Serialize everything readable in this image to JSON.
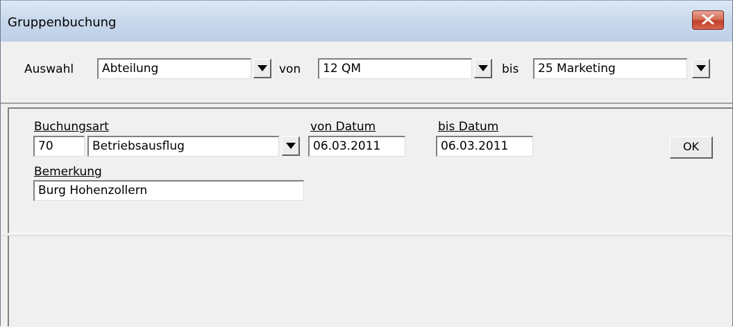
{
  "window": {
    "title": "Gruppenbuchung"
  },
  "selection": {
    "label": "Auswahl",
    "type_value": "Abteilung",
    "from_label": "von",
    "from_value": "12 QM",
    "to_label": "bis",
    "to_value": "25 Marketing"
  },
  "booking": {
    "type_label": "Buchungsart",
    "type_code": "70",
    "type_name": "Betriebsausflug",
    "from_date_label": "von Datum",
    "from_date": "06.03.2011",
    "to_date_label": "bis Datum",
    "to_date": "06.03.2011",
    "remark_label": "Bemerkung",
    "remark": "Burg Hohenzollern",
    "ok_label": "OK"
  },
  "icons": {
    "close": "close-icon",
    "dropdown": "chevron-down-icon"
  },
  "colors": {
    "titlebar": "#c9d9ec",
    "close_button": "#c0402a",
    "window_bg": "#f0f0f0"
  }
}
